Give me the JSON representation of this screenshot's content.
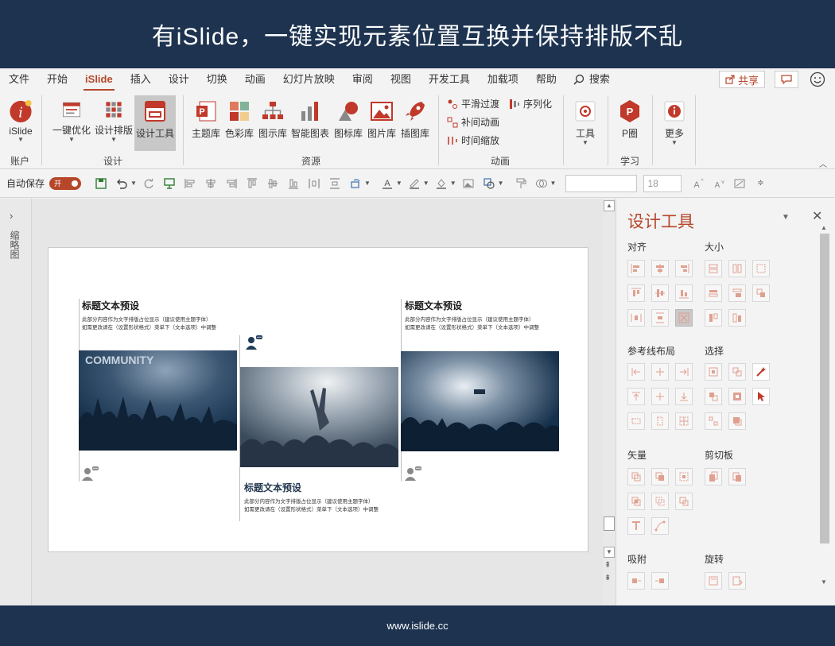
{
  "banner": {
    "headline": "有iSlide，一键实现元素位置互换并保持排版不乱",
    "footer": "www.islide.cc"
  },
  "menu": {
    "tabs": [
      "文件",
      "开始",
      "iSlide",
      "插入",
      "设计",
      "切换",
      "动画",
      "幻灯片放映",
      "审阅",
      "视图",
      "开发工具",
      "加载项",
      "帮助"
    ],
    "active_tab": "iSlide",
    "search_label": "搜索",
    "share_label": "共享"
  },
  "ribbon": {
    "account": {
      "button": "iSlide",
      "group": "账户"
    },
    "design": {
      "buttons": [
        "一键优化",
        "设计排版",
        "设计工具"
      ],
      "group": "设计",
      "active": "设计工具"
    },
    "resources": {
      "buttons": [
        "主题库",
        "色彩库",
        "图示库",
        "智能图表",
        "图标库",
        "图片库",
        "插图库"
      ],
      "group": "资源"
    },
    "animation": {
      "items": [
        "平滑过渡",
        "补间动画",
        "时间缩放",
        "序列化"
      ],
      "group": "动画"
    },
    "tools": {
      "button": "工具"
    },
    "learning": {
      "button": "P圈",
      "group": "学习"
    },
    "more": {
      "button": "更多"
    }
  },
  "quickbar": {
    "autosave_label": "自动保存",
    "autosave_state": "开",
    "font_name": "",
    "font_size": "18"
  },
  "thumbnail_strip": {
    "label": "缩略图"
  },
  "slide": {
    "blocks": [
      {
        "title": "标题文本预设",
        "line1": "此部分内容作为文字排版占位显示（建议使用主题字体）",
        "line2": "如需更改请在（设置形状格式）菜单下（文本选项）中调整"
      },
      {
        "title": "标题文本预设",
        "line1": "此部分内容作为文字排版占位显示（建议使用主题字体）",
        "line2": "如需更改请在（设置形状格式）菜单下（文本选项）中调整"
      },
      {
        "title": "标题文本预设",
        "line1": "此部分内容作为文字排版占位显示（建议使用主题字体）",
        "line2": "如需更改请在（设置形状格式）菜单下（文本选项）中调整"
      }
    ],
    "photo_caption": "COMMUNITY"
  },
  "panel": {
    "title": "设计工具",
    "sections": [
      "对齐",
      "大小",
      "参考线布局",
      "选择",
      "矢量",
      "剪切板",
      "吸附",
      "旋转"
    ]
  },
  "colors": {
    "brand": "#b7472a",
    "banner": "#1d3350",
    "photo_tint": "#1f3a56"
  }
}
